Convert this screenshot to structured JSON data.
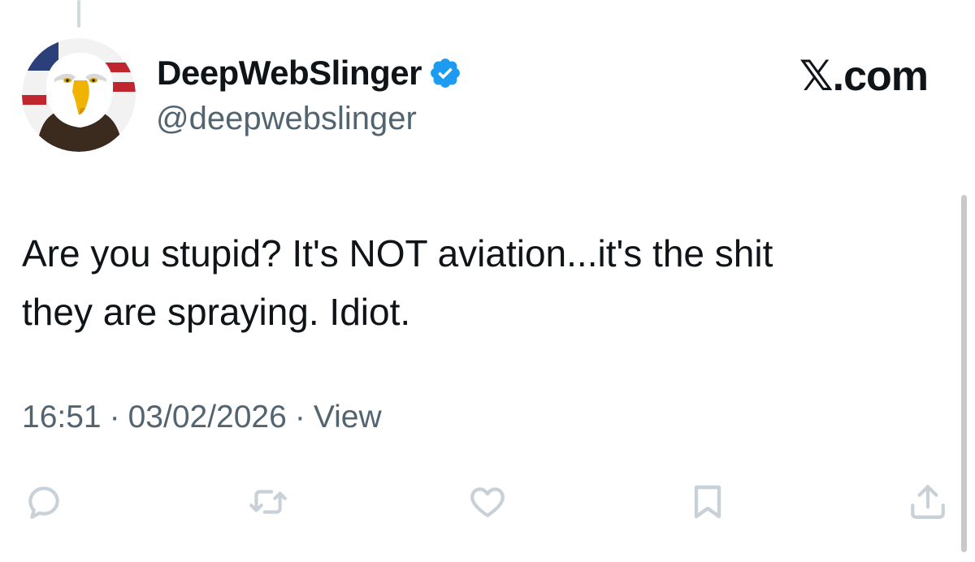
{
  "author": {
    "display_name": "DeepWebSlinger",
    "handle": "@deepwebslinger",
    "verified": true,
    "avatar_icon": "bald-eagle-avatar"
  },
  "watermark": "𝕏.com",
  "tweet": {
    "text": "Are you stupid? It's NOT aviation...it's the shit\nthey are spraying. Idiot."
  },
  "meta": {
    "time": "16:51",
    "separator": "·",
    "date": "03/02/2026",
    "views_label": "View"
  },
  "actions": [
    {
      "icon": "reply-icon"
    },
    {
      "icon": "retweet-icon"
    },
    {
      "icon": "like-heart-icon"
    },
    {
      "icon": "bookmark-icon"
    },
    {
      "icon": "share-icon"
    }
  ],
  "colors": {
    "text_primary": "#0f1419",
    "text_secondary": "#536471",
    "verified_blue": "#1d9bf0",
    "action_icon": "#c8d1d8"
  }
}
